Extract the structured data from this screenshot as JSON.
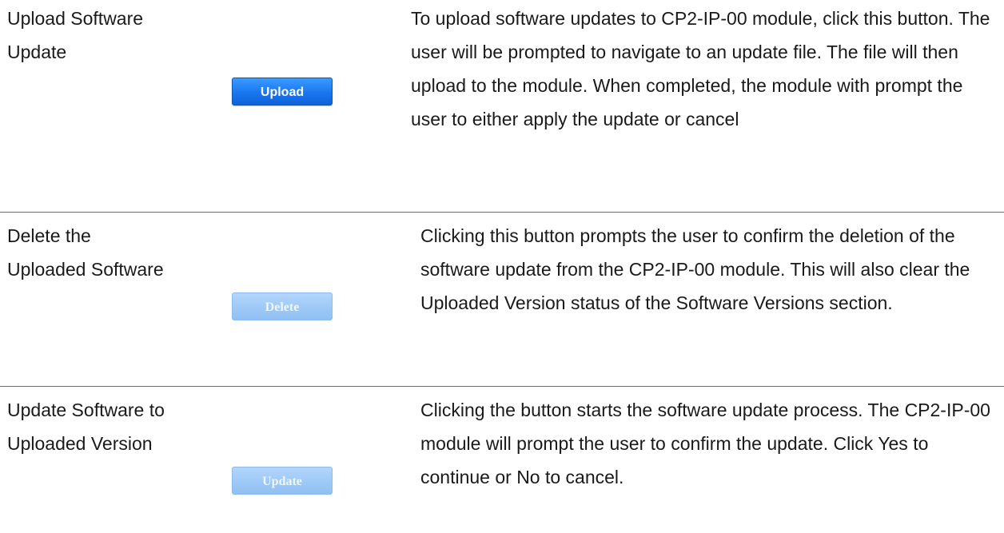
{
  "rows": [
    {
      "label_lines": [
        "Upload Software",
        "Update"
      ],
      "button_label": "Upload",
      "button_state": "enabled",
      "description": "To upload software updates to CP2-IP-00 module, click this button. The user will be prompted to navigate to an update file. The file will then upload to the module. When completed, the module with prompt the user to either apply the update or cancel"
    },
    {
      "label_lines": [
        "Delete the",
        "Uploaded Software"
      ],
      "button_label": "Delete",
      "button_state": "disabled",
      "description": "Clicking this button prompts the user to confirm the deletion of the software update from the CP2-IP-00 module. This will also clear the Uploaded Version status of the Software Versions section."
    },
    {
      "label_lines": [
        "Update Software to",
        "Uploaded Version"
      ],
      "button_label": "Update",
      "button_state": "disabled",
      "description": "Clicking the button starts the software update process. The CP2-IP-00 module will prompt the user to confirm the update. Click Yes to continue or No to cancel."
    }
  ],
  "colors": {
    "button_enabled": "#1976f0",
    "button_disabled": "#9cc8f6",
    "divider": "#6b6b6b"
  }
}
